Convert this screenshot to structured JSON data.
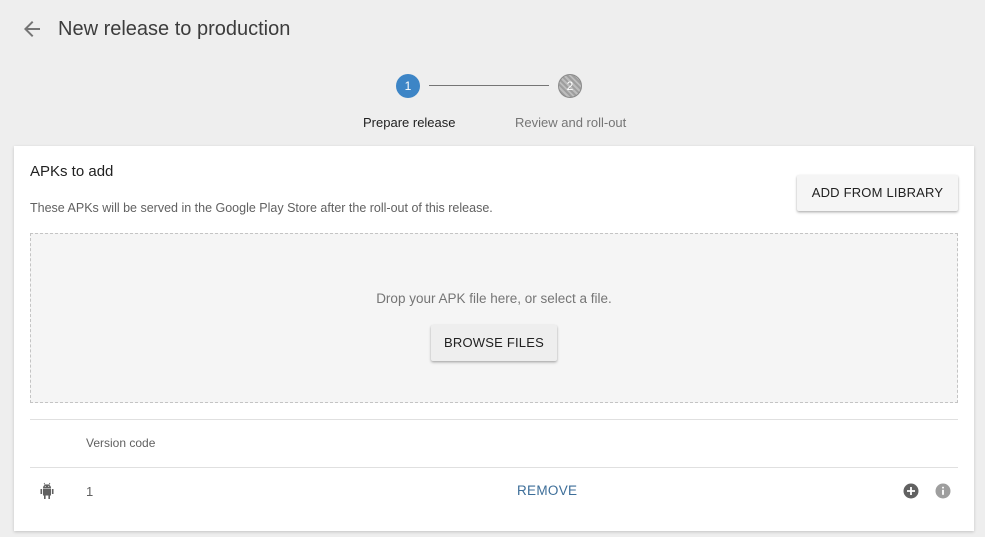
{
  "header": {
    "back_icon": "arrow-left-icon",
    "title": "New release to production"
  },
  "stepper": {
    "steps": [
      {
        "number": "1",
        "label": "Prepare release",
        "state": "active"
      },
      {
        "number": "2",
        "label": "Review and roll-out",
        "state": "inactive"
      }
    ]
  },
  "apks": {
    "title": "APKs to add",
    "description": "These APKs will be served in the Google Play Store after the roll-out of this release.",
    "add_from_library_label": "ADD FROM LIBRARY",
    "dropzone_text": "Drop your APK file here, or select a file.",
    "browse_label": "BROWSE FILES",
    "table": {
      "columns": [
        "Version code"
      ],
      "rows": [
        {
          "icon": "android-icon",
          "version_code": "1",
          "remove_label": "REMOVE"
        }
      ]
    }
  },
  "colors": {
    "accent": "#3d85c6",
    "link": "#3d6e99",
    "background": "#eeeeee"
  }
}
